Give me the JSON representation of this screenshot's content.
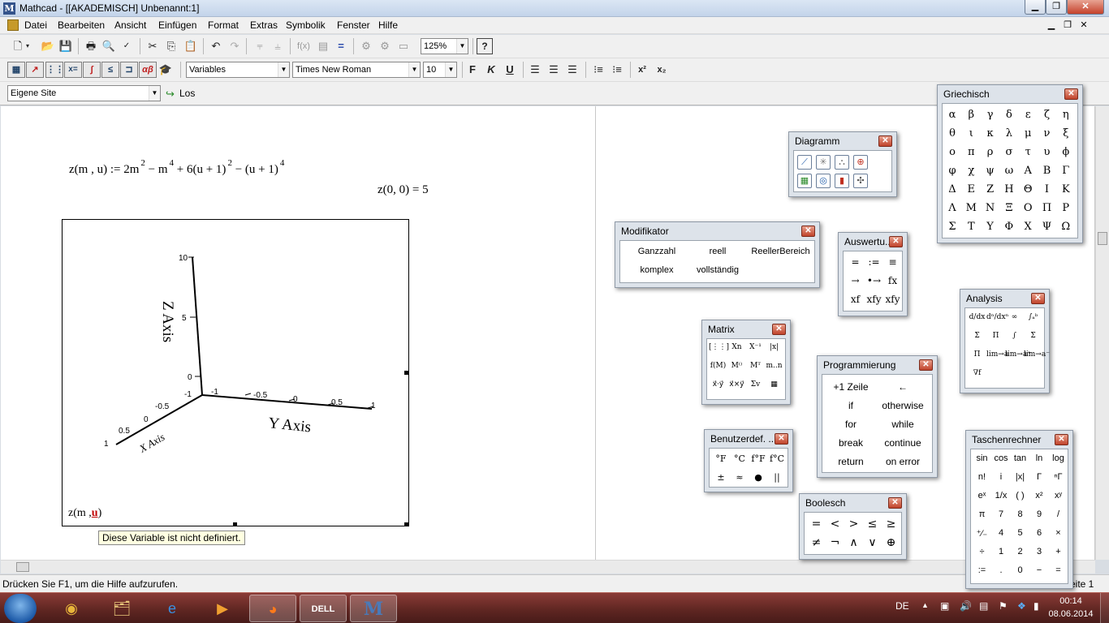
{
  "window": {
    "title": "Mathcad - [[AKADEMISCH] Unbenannt:1]",
    "minimize": "▁",
    "maximize": "❐",
    "close": "✕"
  },
  "menu": {
    "items": [
      "Datei",
      "Bearbeiten",
      "Ansicht",
      "Einfügen",
      "Format",
      "Extras",
      "Symbolik",
      "Fenster",
      "Hilfe"
    ]
  },
  "toolbar": {
    "zoom": "125%",
    "style": "Variables",
    "font": "Times New Roman",
    "size": "10",
    "bold": "F",
    "italic": "K",
    "underline": "U",
    "superscript": "x²",
    "subscript": "x₂"
  },
  "resources": {
    "site": "Eigene Site",
    "go": "Los"
  },
  "worksheet": {
    "def_lhs": "z(m , u) := 2m",
    "def_e1": "2",
    "def_mid1": " − m",
    "def_e2": "4",
    "def_mid2": " + 6(u + 1)",
    "def_e3": "2",
    "def_mid3": " − (u + 1)",
    "def_e4": "4",
    "eval": "z(0, 0)  =  5",
    "plot_expr_prefix": "z(m ,",
    "plot_expr_var": "u",
    "plot_expr_suffix": ")",
    "error_tooltip": "Diese Variable ist nicht definiert."
  },
  "plot": {
    "z_label": "Z Axis",
    "y_label": "Y Axis",
    "x_label": "X Axis",
    "z_ticks": [
      "10",
      "5",
      "0",
      "-1"
    ],
    "y_ticks": [
      "-1",
      "-0.5",
      "0",
      "0.5",
      "1"
    ],
    "x_ticks": [
      "-0.5",
      "0",
      "0.5",
      "1"
    ]
  },
  "status": {
    "text": "Drücken Sie F1, um die Hilfe aufzurufen.",
    "page": "eite 1"
  },
  "palettes": {
    "griechisch": {
      "title": "Griechisch",
      "rows": [
        [
          "α",
          "β",
          "γ",
          "δ",
          "ε",
          "ζ",
          "η"
        ],
        [
          "θ",
          "ι",
          "κ",
          "λ",
          "μ",
          "ν",
          "ξ"
        ],
        [
          "ο",
          "π",
          "ρ",
          "σ",
          "τ",
          "υ",
          "ϕ"
        ],
        [
          "φ",
          "χ",
          "ψ",
          "ω",
          "Α",
          "Β",
          "Γ"
        ],
        [
          "Δ",
          "Ε",
          "Ζ",
          "Η",
          "Θ",
          "Ι",
          "Κ"
        ],
        [
          "Λ",
          "Μ",
          "Ν",
          "Ξ",
          "Ο",
          "Π",
          "Ρ"
        ],
        [
          "Σ",
          "Τ",
          "Υ",
          "Φ",
          "Χ",
          "Ψ",
          "Ω"
        ]
      ]
    },
    "diagramm": {
      "title": "Diagramm",
      "icons": [
        "x-y-plot-icon",
        "polar-plot-icon",
        "surface-plot-icon",
        "contour-plot-icon",
        "3d-bar-plot-icon",
        "3d-scatter-plot-icon",
        "vector-field-plot-icon",
        "quickplot-icon"
      ],
      "glyphs": [
        "⟋",
        "✳",
        "⛬",
        "⊕",
        "▦",
        "◎",
        "▮",
        "✣"
      ]
    },
    "modifikator": {
      "title": "Modifikator",
      "row1": [
        "Ganzzahl",
        "reell",
        "ReellerBereich"
      ],
      "row2": [
        "komplex",
        "vollständig"
      ]
    },
    "auswertung": {
      "title": "Auswertu...",
      "rows": [
        [
          "=",
          ":=",
          "≡"
        ],
        [
          "→",
          "•→",
          "fx"
        ],
        [
          "xf",
          "xfy",
          "xfy"
        ]
      ]
    },
    "analysis": {
      "title": "Analysis",
      "rows": [
        [
          "d/dx",
          "dⁿ/dxⁿ",
          "∞",
          "∫ₐᵇ"
        ],
        [
          "Σ",
          "Π",
          "∫",
          "Σ"
        ],
        [
          "Π",
          "lim→a",
          "lim→a⁺",
          "lim→a⁻"
        ],
        [
          "∇f"
        ]
      ]
    },
    "matrix": {
      "title": "Matrix",
      "rows": [
        [
          "[⋮⋮]",
          "Xn",
          "X⁻¹",
          "|x|"
        ],
        [
          "f(M)",
          "M⁽⁾",
          "Mᵀ",
          "m..n"
        ],
        [
          "x⃗·y⃗",
          "x⃗×y⃗",
          "Σv",
          "▦"
        ]
      ]
    },
    "programmierung": {
      "title": "Programmierung",
      "rows": [
        [
          "+1 Zeile",
          "←"
        ],
        [
          "if",
          "otherwise"
        ],
        [
          "for",
          "while"
        ],
        [
          "break",
          "continue"
        ],
        [
          "return",
          "on error"
        ]
      ]
    },
    "benutzerdef": {
      "title": "Benutzerdef. ...",
      "rows": [
        [
          "°F",
          "°C",
          "f°F",
          "f°C"
        ],
        [
          "±",
          "≈",
          "●",
          "||"
        ]
      ]
    },
    "boolesch": {
      "title": "Boolesch",
      "rows": [
        [
          "=",
          "<",
          ">",
          "≤",
          "≥"
        ],
        [
          "≠",
          "¬",
          "∧",
          "∨",
          "⊕"
        ]
      ]
    },
    "taschenrechner": {
      "title": "Taschenrechner",
      "rows": [
        [
          "sin",
          "cos",
          "tan",
          "ln",
          "log"
        ],
        [
          "n!",
          "i",
          "|x|",
          "Γ",
          "ⁿΓ"
        ],
        [
          "eˣ",
          "1/x",
          "( )",
          "x²",
          "xʸ"
        ],
        [
          "π",
          "7",
          "8",
          "9",
          "/"
        ],
        [
          "⁺∕₋",
          "4",
          "5",
          "6",
          "×"
        ],
        [
          "÷",
          "1",
          "2",
          "3",
          "+"
        ],
        [
          ":=",
          ".",
          "0",
          "−",
          "="
        ]
      ]
    }
  },
  "taskbar": {
    "lang": "DE",
    "time": "00:14",
    "date": "08.06.2014",
    "apps": [
      "chrome-icon",
      "explorer-icon",
      "ie-icon",
      "media-player-icon",
      "firefox-icon",
      "dell-icon",
      "mathcad-icon"
    ],
    "app_glyphs": [
      "◉",
      "🗂",
      "e",
      "▶",
      "◕",
      "DELL",
      "M"
    ]
  }
}
